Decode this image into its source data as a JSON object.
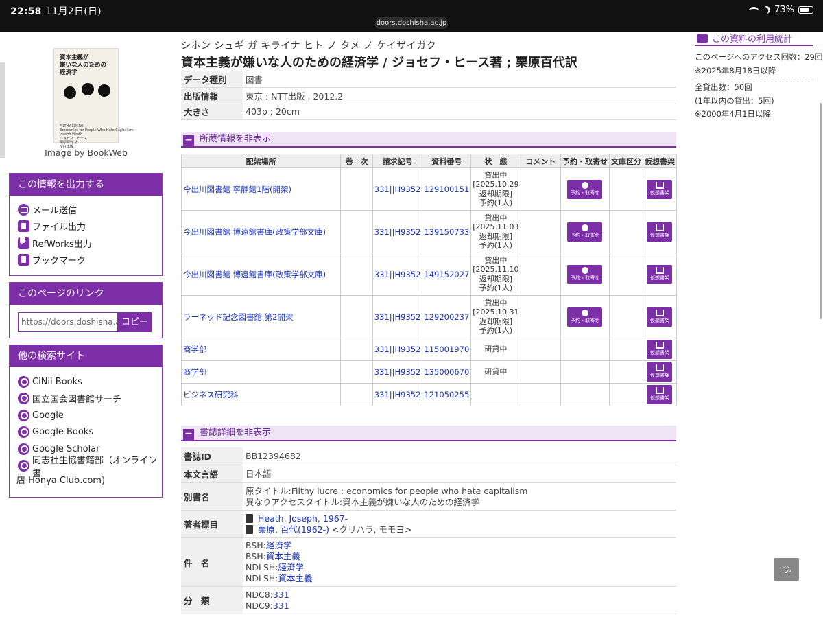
{
  "statusbar": {
    "time": "22:58",
    "date": "11月2日(日)",
    "url": "doors.doshisha.ac.jp",
    "battery": "73%"
  },
  "cover": {
    "title": "資本主義が\n嫌いな人のための\n経済学",
    "footer": "FILTHY LUCRE\nEconomics for People Who Hate Capitalism\nJoseph Heath\nジョセフ・ヒース\n栗原百代 訳\nNTT出版",
    "credit": "Image by BookWeb"
  },
  "export_box": {
    "title": "この情報を出力する",
    "items": [
      {
        "label": "メール送信",
        "icon": "mail-icon"
      },
      {
        "label": "ファイル出力",
        "icon": "file-icon"
      },
      {
        "label": "RefWorks出力",
        "icon": "external-link-icon"
      },
      {
        "label": "ブックマーク",
        "icon": "bookmark-icon"
      }
    ]
  },
  "link_box": {
    "title": "このページのリンク",
    "url": "https://doors.doshisha.ac.jp/opac/",
    "copy_label": "コピー"
  },
  "search_box": {
    "title": "他の検索サイト",
    "items": [
      "CiNii Books",
      "国立国会図書館サーチ",
      "Google",
      "Google Books",
      "Google Scholar"
    ],
    "last_line1": "同志社生協書籍部（オンライン書",
    "last_line2": "店 Honya Club.com)"
  },
  "record": {
    "kana": "シホン シュギ ガ キライナ ヒト ノ タメ ノ ケイザイガク",
    "title": "資本主義が嫌いな人のための経済学 / ジョセフ・ヒース著 ; 栗原百代訳"
  },
  "meta": [
    {
      "key": "データ種別",
      "value": "図書"
    },
    {
      "key": "出版情報",
      "value": "東京 : NTT出版 , 2012.2"
    },
    {
      "key": "大きさ",
      "value": "403p ; 20cm"
    }
  ],
  "holdings_section": {
    "label": "所蔵情報を非表示"
  },
  "holdings_headers": [
    "配架場所",
    "巻　次",
    "請求記号",
    "資料番号",
    "状　態",
    "コメント",
    "予約・取寄せ",
    "文庫区分",
    "仮想書架"
  ],
  "holdings": [
    {
      "loc": "今出川図書館 寧静館1階(開架)",
      "call": "331||H9352",
      "id": "129100151",
      "status": [
        "貸出中",
        "[2025.10.29",
        "返却期限]",
        "予約(1人)"
      ],
      "reserve": true
    },
    {
      "loc": "今出川図書館 博遠館書庫(政策学部文庫)",
      "call": "331||H9352",
      "id": "139150733",
      "status": [
        "貸出中",
        "[2025.11.03",
        "返却期限]",
        "予約(1人)"
      ],
      "reserve": true
    },
    {
      "loc": "今出川図書館 博遠館書庫(政策学部文庫)",
      "call": "331||H9352",
      "id": "149152027",
      "status": [
        "貸出中",
        "[2025.11.10",
        "返却期限]",
        "予約(1人)"
      ],
      "reserve": true
    },
    {
      "loc": "ラーネッド記念図書館 第2開架",
      "call": "331||H9352",
      "id": "129200237",
      "status": [
        "貸出中",
        "[2025.10.31",
        "返却期限]",
        "予約(1人)"
      ],
      "reserve": true
    },
    {
      "loc": "商学部",
      "call": "331||H9352",
      "id": "115001970",
      "status": [
        "研貸中"
      ],
      "reserve": false
    },
    {
      "loc": "商学部",
      "call": "331||H9352",
      "id": "135000670",
      "status": [
        "研貸中"
      ],
      "reserve": false
    },
    {
      "loc": "ビジネス研究科",
      "call": "331||H9352",
      "id": "121050255",
      "status": [],
      "reserve": false
    }
  ],
  "button_labels": {
    "reserve": "予約・取寄せ",
    "virtual": "仮想書架"
  },
  "bib_section": {
    "label": "書誌詳細を非表示"
  },
  "bib": {
    "id_key": "書誌ID",
    "id": "BB12394682",
    "lang_key": "本文言語",
    "lang": "日本語",
    "alt_key": "別書名",
    "alt1": "原タイトル:Filthy lucre : economics for people who hate capitalism",
    "alt2": "異なりアクセスタイトル:資本主義が嫌いな人のための経済学",
    "author_key": "著者標目",
    "author1": "Heath, Joseph, 1967-",
    "author2": "栗原, 百代(1962-)",
    "author2_reading": "<クリハラ, モモヨ>",
    "subject_key": "件　名",
    "subjects": [
      {
        "pre": "BSH:",
        "link": "経済学"
      },
      {
        "pre": "BSH:",
        "link": "資本主義"
      },
      {
        "pre": "NDLSH:",
        "link": "経済学"
      },
      {
        "pre": "NDLSH:",
        "link": "資本主義"
      }
    ],
    "class_key": "分　類",
    "classes": [
      {
        "pre": "NDC8:",
        "link": "331"
      },
      {
        "pre": "NDC9:",
        "link": "331"
      }
    ]
  },
  "stats": {
    "title": "この資料の利用統計",
    "access": "このページへのアクセス回数：29回",
    "access_since": "※2025年8月18日以降",
    "loans": "全貸出数：50回",
    "loans_year": "(1年以内の貸出：5回)",
    "loans_since": "※2000年4月1日以降"
  },
  "top_label": "TOP"
}
